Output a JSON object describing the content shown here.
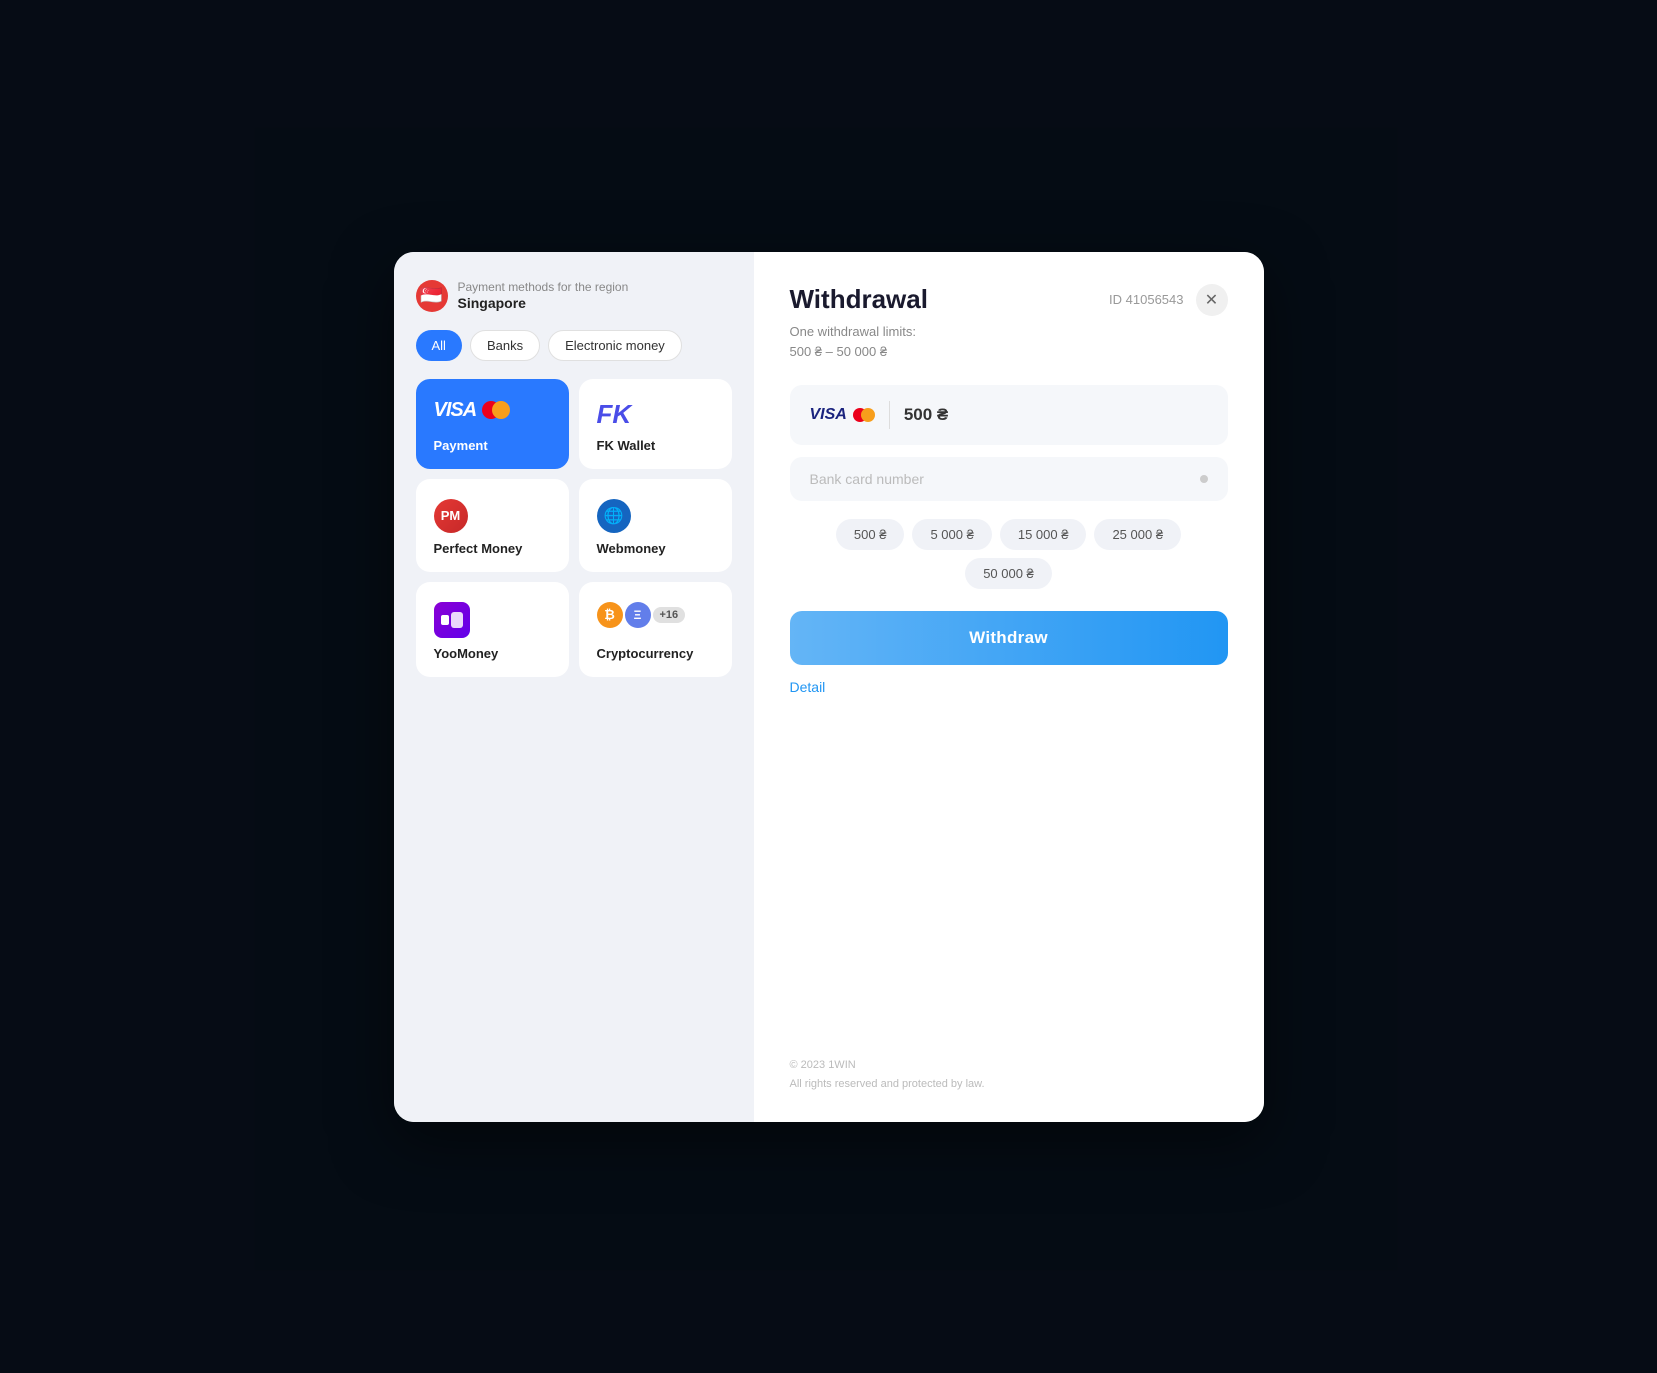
{
  "modal": {
    "region_label": "Payment methods for the region",
    "region_name": "Singapore",
    "filters": [
      {
        "label": "All",
        "active": true
      },
      {
        "label": "Banks",
        "active": false
      },
      {
        "label": "Electronic money",
        "active": false
      }
    ],
    "payment_methods": [
      {
        "id": "visa",
        "label": "Payment",
        "active": true
      },
      {
        "id": "fk_wallet",
        "label": "FK Wallet",
        "active": false
      },
      {
        "id": "perfect_money",
        "label": "Perfect Money",
        "active": false
      },
      {
        "id": "webmoney",
        "label": "Webmoney",
        "active": false
      },
      {
        "id": "yoomoney",
        "label": "YooMoney",
        "active": false
      },
      {
        "id": "cryptocurrency",
        "label": "Cryptocurrency",
        "active": false
      }
    ],
    "withdrawal": {
      "title": "Withdrawal",
      "transaction_id": "ID 41056543",
      "limit_line1": "One withdrawal limits:",
      "limit_line2": "500 ₴ – 50 000 ₴",
      "amount_display": "500 ₴",
      "card_input_placeholder": "Bank card number",
      "quick_amounts": [
        "500 ₴",
        "5 000 ₴",
        "15 000 ₴",
        "25 000 ₴",
        "50 000 ₴"
      ],
      "withdraw_button": "Withdraw",
      "detail_link": "Detail",
      "footer_copyright": "© 2023 1WIN",
      "footer_rights": "All rights reserved and protected by law."
    }
  }
}
